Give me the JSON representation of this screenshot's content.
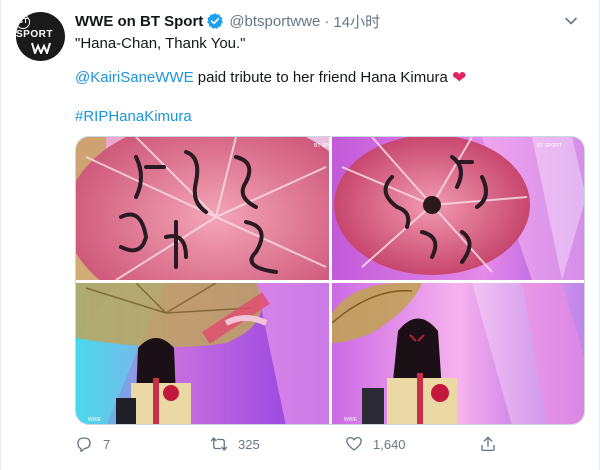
{
  "account": {
    "avatar_text": "BT SPORT",
    "name": "WWE on BT Sport",
    "handle": "@btsportwwe",
    "separator": "·",
    "time": "14小时"
  },
  "tweet": {
    "line1": "\"Hana-Chan, Thank You.\"",
    "mention": "@KairiSaneWWE",
    "line2_rest": " paid tribute to her friend Hana Kimura",
    "heart": "❤",
    "hashtag": "#RIPHanaKimura"
  },
  "media": {
    "images": [
      {
        "description_icon": "umbrella-closeup-left"
      },
      {
        "description_icon": "umbrella-closeup-right"
      },
      {
        "description_icon": "wrestler-holding-umbrella-left"
      },
      {
        "description_icon": "wrestler-holding-umbrella-right"
      }
    ],
    "watermark": "BT SPORT"
  },
  "actions": {
    "replies": "7",
    "retweets": "325",
    "likes": "1,640"
  },
  "colors": {
    "link": "#1b95e0",
    "muted": "#657786",
    "heart": "#e0245e",
    "verified": "#1da1f2"
  }
}
